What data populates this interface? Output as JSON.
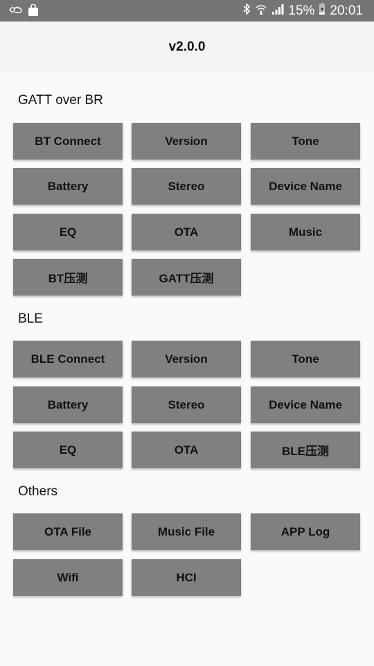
{
  "status_bar": {
    "left_icons": [
      "weather-icon",
      "shopping-bag-icon"
    ],
    "right_icons": [
      "bluetooth-icon",
      "wifi-icon",
      "signal-icon"
    ],
    "battery": "15%",
    "time": "20:01"
  },
  "app_bar": {
    "title": "v2.0.0"
  },
  "sections": [
    {
      "title": "GATT over BR",
      "buttons": [
        "BT Connect",
        "Version",
        "Tone",
        "Battery",
        "Stereo",
        "Device Name",
        "EQ",
        "OTA",
        "Music",
        "BT压测",
        "GATT压测"
      ]
    },
    {
      "title": "BLE",
      "buttons": [
        "BLE Connect",
        "Version",
        "Tone",
        "Battery",
        "Stereo",
        "Device Name",
        "EQ",
        "OTA",
        "BLE压测"
      ]
    },
    {
      "title": "Others",
      "buttons": [
        "OTA File",
        "Music File",
        "APP Log",
        "Wifi",
        "HCI"
      ]
    }
  ],
  "colors": {
    "button_bg": "#808080",
    "status_bar": "#757575",
    "app_bar": "#f4f4f4",
    "background": "#fafafa"
  }
}
